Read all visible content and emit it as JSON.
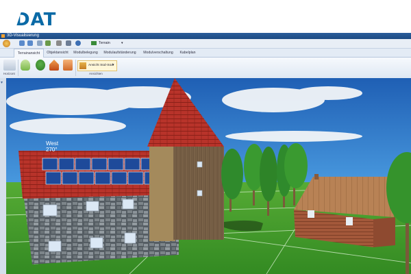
{
  "brand": {
    "logo_text": "DAT",
    "color": "#0a6aa6"
  },
  "window": {
    "title": "3D-Visualisierung"
  },
  "quick_access": {
    "terrain_label": "Terrain"
  },
  "tabs": [
    {
      "label": "Terrainansicht",
      "active": true
    },
    {
      "label": "Objektansicht"
    },
    {
      "label": "Modulbelegung"
    },
    {
      "label": "Modulaufständerung"
    },
    {
      "label": "Modulverschaltung"
    },
    {
      "label": "Kabelplan"
    }
  ],
  "ribbon": {
    "group1_label": "Horizont",
    "view_select": "Ansicht Süd-Süd",
    "group_view_label": "Ansichten"
  },
  "scene": {
    "facade_label_line1": "West",
    "facade_label_line2": "270°",
    "sky_color": "#1b73c9",
    "ground_color": "#3f9a2c"
  }
}
